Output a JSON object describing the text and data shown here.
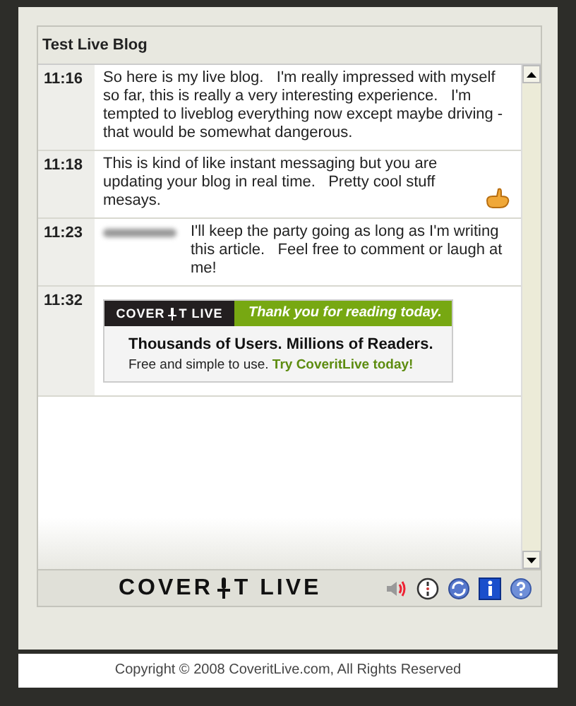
{
  "blog_title": "Test Live Blog",
  "entries": [
    {
      "time": "11:16",
      "kind": "text",
      "redacted_name": false,
      "emoticon": false,
      "text": "So here is my live blog.   I'm really impressed with myself so far, this is really a very interesting experience.   I'm tempted to liveblog everything now except maybe driving - that would be somewhat dangerous."
    },
    {
      "time": "11:18",
      "kind": "text",
      "redacted_name": false,
      "emoticon": true,
      "text": "This is kind of like instant messaging but you are updating your blog in real time.   Pretty cool stuff mesays."
    },
    {
      "time": "11:23",
      "kind": "text",
      "redacted_name": true,
      "emoticon": false,
      "text": "I'll keep the party going as long as I'm writing this article.   Feel free to comment or laugh at me!"
    },
    {
      "time": "11:32",
      "kind": "ad",
      "ad": {
        "logo_left": "COVER",
        "logo_right": "T LIVE",
        "tagline": "Thank you for reading today.",
        "headline": "Thousands of Users. Millions of Readers.",
        "body": "Free and simple to use.",
        "link": "Try CoveritLive today!"
      }
    }
  ],
  "footer": {
    "logo_left": "COVER",
    "logo_right": "T LIVE"
  },
  "copyright": "Copyright © 2008 CoveritLive.com, All Rights Reserved"
}
